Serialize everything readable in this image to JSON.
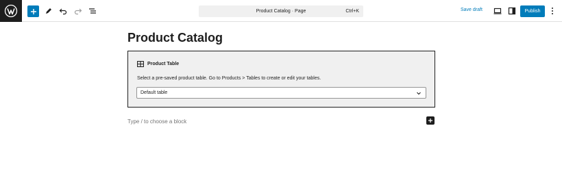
{
  "toolbar": {
    "command_title": "Product Catalog · Page",
    "command_shortcut": "Ctrl+K",
    "save_draft": "Save draft",
    "publish": "Publish"
  },
  "page": {
    "title": "Product Catalog"
  },
  "block": {
    "heading": "Product Table",
    "description": "Select a pre-saved product table. Go to Products > Tables to create or edit your tables.",
    "selected_table": "Default table"
  },
  "appender": {
    "placeholder": "Type / to choose a block"
  },
  "colors": {
    "accent": "#007cba",
    "dark": "#1e1e1e"
  },
  "icons": [
    "wordpress-logo-icon",
    "plus-icon",
    "pen-icon",
    "undo-icon",
    "redo-icon",
    "list-view-icon",
    "preview-icon",
    "sidebar-icon",
    "more-options-icon",
    "table-icon",
    "chevron-down-icon"
  ]
}
